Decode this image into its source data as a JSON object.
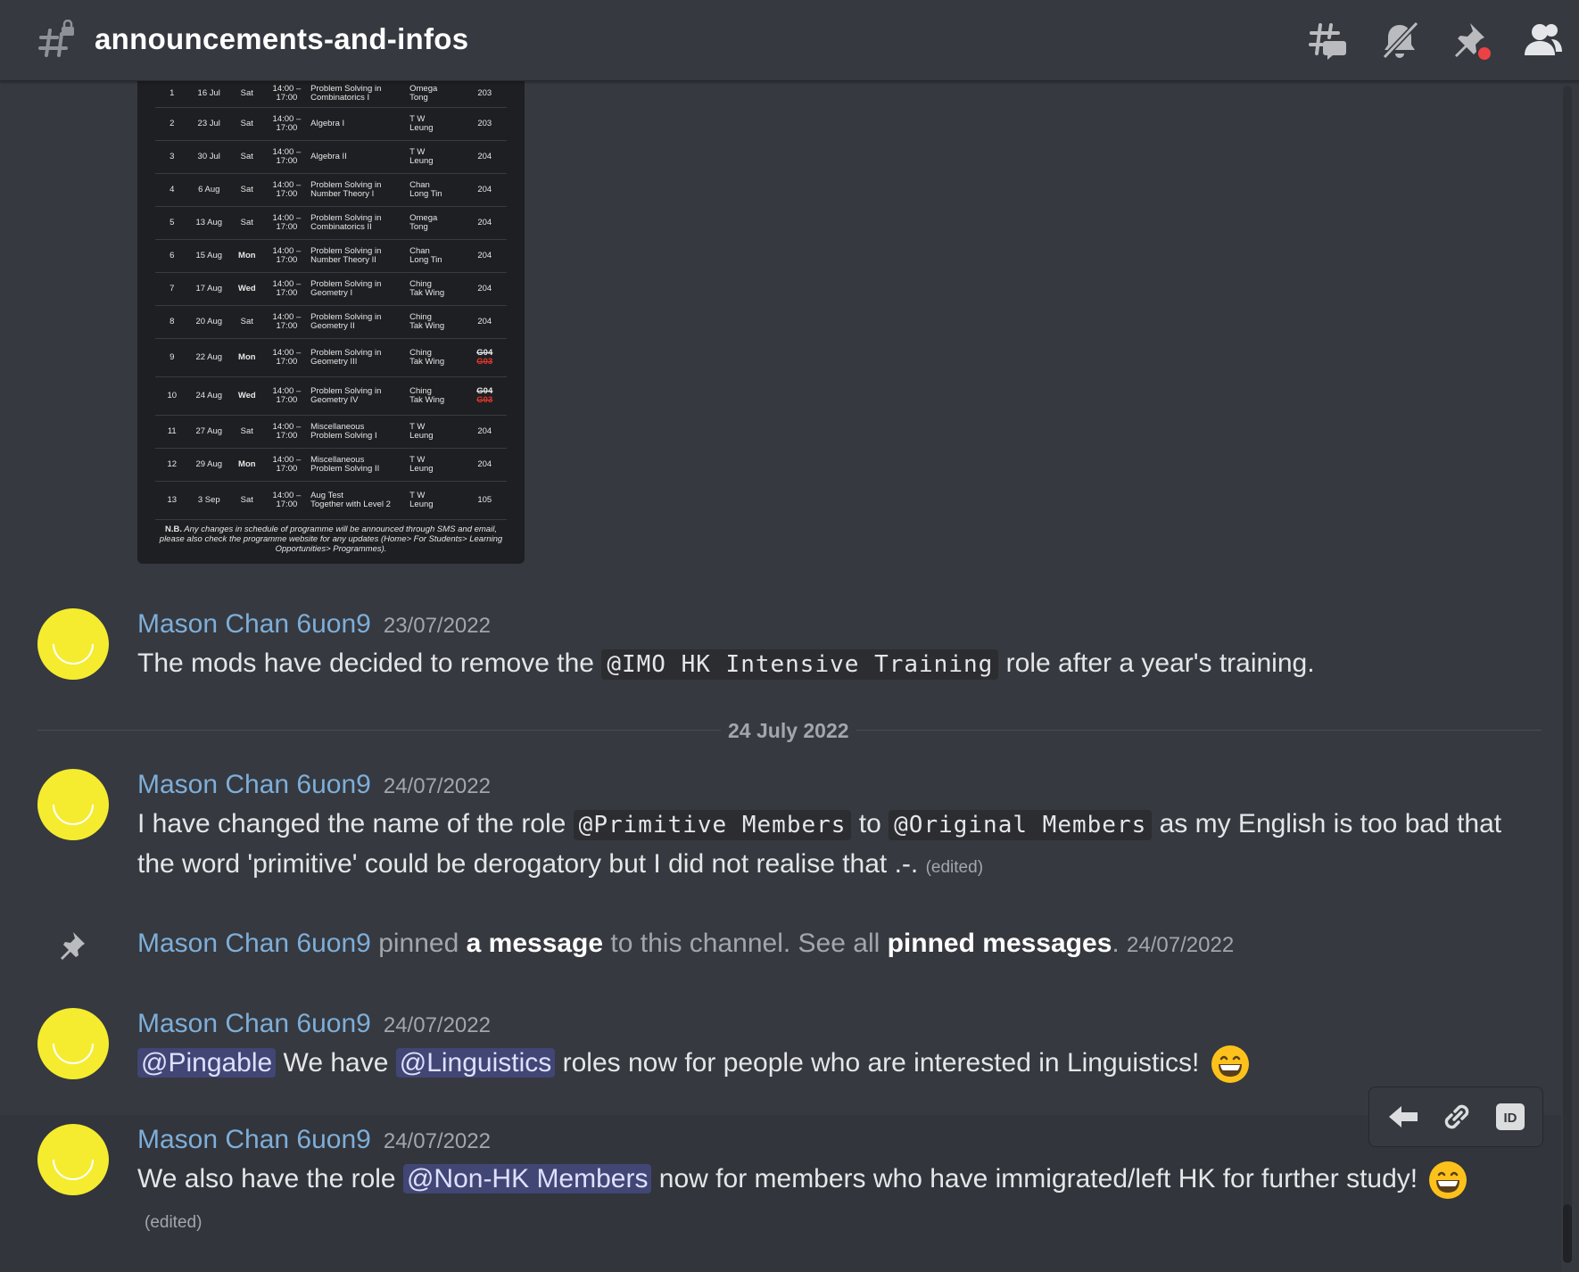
{
  "header": {
    "channel_name": "announcements-and-infos",
    "icons": [
      "hashtag-lock-icon",
      "threads-icon",
      "notifications-muted-icon",
      "pinned-messages-icon",
      "member-list-icon"
    ]
  },
  "schedule": {
    "rows": [
      {
        "no": "1",
        "date": "16 Jul",
        "day": "Sat",
        "time1": "14:00 –",
        "time2": "17:00",
        "topic1": "Problem Solving in",
        "topic2": "Combinatorics I",
        "tutor1": "Omega",
        "tutor2": "Tong",
        "room": "203"
      },
      {
        "no": "2",
        "date": "23 Jul",
        "day": "Sat",
        "time1": "14:00 –",
        "time2": "17:00",
        "topic1": "Algebra I",
        "topic2": "",
        "tutor1": "T W",
        "tutor2": "Leung",
        "room": "203"
      },
      {
        "no": "3",
        "date": "30 Jul",
        "day": "Sat",
        "time1": "14:00 –",
        "time2": "17:00",
        "topic1": "Algebra II",
        "topic2": "",
        "tutor1": "T W",
        "tutor2": "Leung",
        "room": "204"
      },
      {
        "no": "4",
        "date": "6 Aug",
        "day": "Sat",
        "time1": "14:00 –",
        "time2": "17:00",
        "topic1": "Problem Solving in",
        "topic2": "Number Theory I",
        "tutor1": "Chan",
        "tutor2": "Long Tin",
        "room": "204"
      },
      {
        "no": "5",
        "date": "13 Aug",
        "day": "Sat",
        "time1": "14:00 –",
        "time2": "17:00",
        "topic1": "Problem Solving in",
        "topic2": "Combinatorics II",
        "tutor1": "Omega",
        "tutor2": "Tong",
        "room": "204"
      },
      {
        "no": "6",
        "date": "15 Aug",
        "day": "Mon",
        "time1": "14:00 –",
        "time2": "17:00",
        "topic1": "Problem Solving in",
        "topic2": "Number Theory II",
        "tutor1": "Chan",
        "tutor2": "Long Tin",
        "room": "204"
      },
      {
        "no": "7",
        "date": "17 Aug",
        "day": "Wed",
        "time1": "14:00 –",
        "time2": "17:00",
        "topic1": "Problem Solving in",
        "topic2": "Geometry I",
        "tutor1": "Ching",
        "tutor2": "Tak Wing",
        "room": "204"
      },
      {
        "no": "8",
        "date": "20 Aug",
        "day": "Sat",
        "time1": "14:00 –",
        "time2": "17:00",
        "topic1": "Problem Solving in",
        "topic2": "Geometry II",
        "tutor1": "Ching",
        "tutor2": "Tak Wing",
        "room": "204"
      },
      {
        "no": "9",
        "date": "22 Aug",
        "day": "Mon",
        "time1": "14:00 –",
        "time2": "17:00",
        "topic1": "Problem Solving in",
        "topic2": "Geometry III",
        "tutor1": "Ching",
        "tutor2": "Tak Wing",
        "room_old": "G04",
        "room_new": "G03"
      },
      {
        "no": "10",
        "date": "24 Aug",
        "day": "Wed",
        "time1": "14:00 –",
        "time2": "17:00",
        "topic1": "Problem Solving in",
        "topic2": "Geometry IV",
        "tutor1": "Ching",
        "tutor2": "Tak Wing",
        "room_old": "G04",
        "room_new": "G03"
      },
      {
        "no": "11",
        "date": "27 Aug",
        "day": "Sat",
        "time1": "14:00 –",
        "time2": "17:00",
        "topic1": "Miscellaneous",
        "topic2": "Problem Solving I",
        "tutor1": "T W",
        "tutor2": "Leung",
        "room": "204"
      },
      {
        "no": "12",
        "date": "29 Aug",
        "day": "Mon",
        "time1": "14:00 –",
        "time2": "17:00",
        "topic1": "Miscellaneous",
        "topic2": "Problem Solving II",
        "tutor1": "T W",
        "tutor2": "Leung",
        "room": "204"
      },
      {
        "no": "13",
        "date": "3 Sep",
        "day": "Sat",
        "time1": "14:00 –",
        "time2": "17:00",
        "topic1": "Aug Test",
        "topic2": "Together with Level 2",
        "tutor1": "T W",
        "tutor2": "Leung",
        "room": "105"
      }
    ],
    "note_bold": "N.B.",
    "note_text": " Any changes in schedule of programme will be announced through SMS and email, please also check the programme website for any updates (Home> For Students> Learning Opportunities> Programmes)."
  },
  "messages": [
    {
      "author": "Mason Chan 6uon9",
      "timestamp": "23/07/2022",
      "pre": "The mods have decided to remove the ",
      "code": "@IMO HK Intensive Training",
      "post": " role after a year's training."
    },
    {
      "author": "Mason Chan 6uon9",
      "timestamp": "24/07/2022",
      "pre": "I have changed the name of the role ",
      "code1": "@Primitive Members",
      "mid": " to ",
      "code2": "@Original Members",
      "post": " as my English is too bad that the word 'primitive' could be derogatory but I did not realise that .-. ",
      "edited": "(edited)"
    },
    {
      "author": "Mason Chan 6uon9",
      "timestamp": "24/07/2022",
      "mention1": "@Pingable",
      "mid1": " We have ",
      "mention2": "@Linguistics",
      "post": " roles now for people who are interested in Linguistics! ",
      "emoji": "grinning-face-emoji"
    },
    {
      "author": "Mason Chan 6uon9",
      "timestamp": "24/07/2022",
      "pre": "We also have the role ",
      "mention": "@Non-HK Members",
      "post": " now for members who have immigrated/left HK for further study! ",
      "emoji": "grinning-face-emoji",
      "edited": "(edited)"
    }
  ],
  "divider": {
    "label": "24 July 2022"
  },
  "system_message": {
    "author": "Mason Chan 6uon9",
    "text1": " pinned ",
    "link1": "a message",
    "text2": " to this channel. See all ",
    "link2": "pinned messages",
    "text3": ". ",
    "timestamp": "24/07/2022"
  },
  "toolbar": {
    "icons": [
      "reply-icon",
      "copy-link-icon",
      "copy-id-icon"
    ]
  },
  "colors": {
    "background": "#36393f",
    "author": "#7eaed9",
    "mention_bg": "#414675",
    "avatar": "#f5ec2f"
  }
}
